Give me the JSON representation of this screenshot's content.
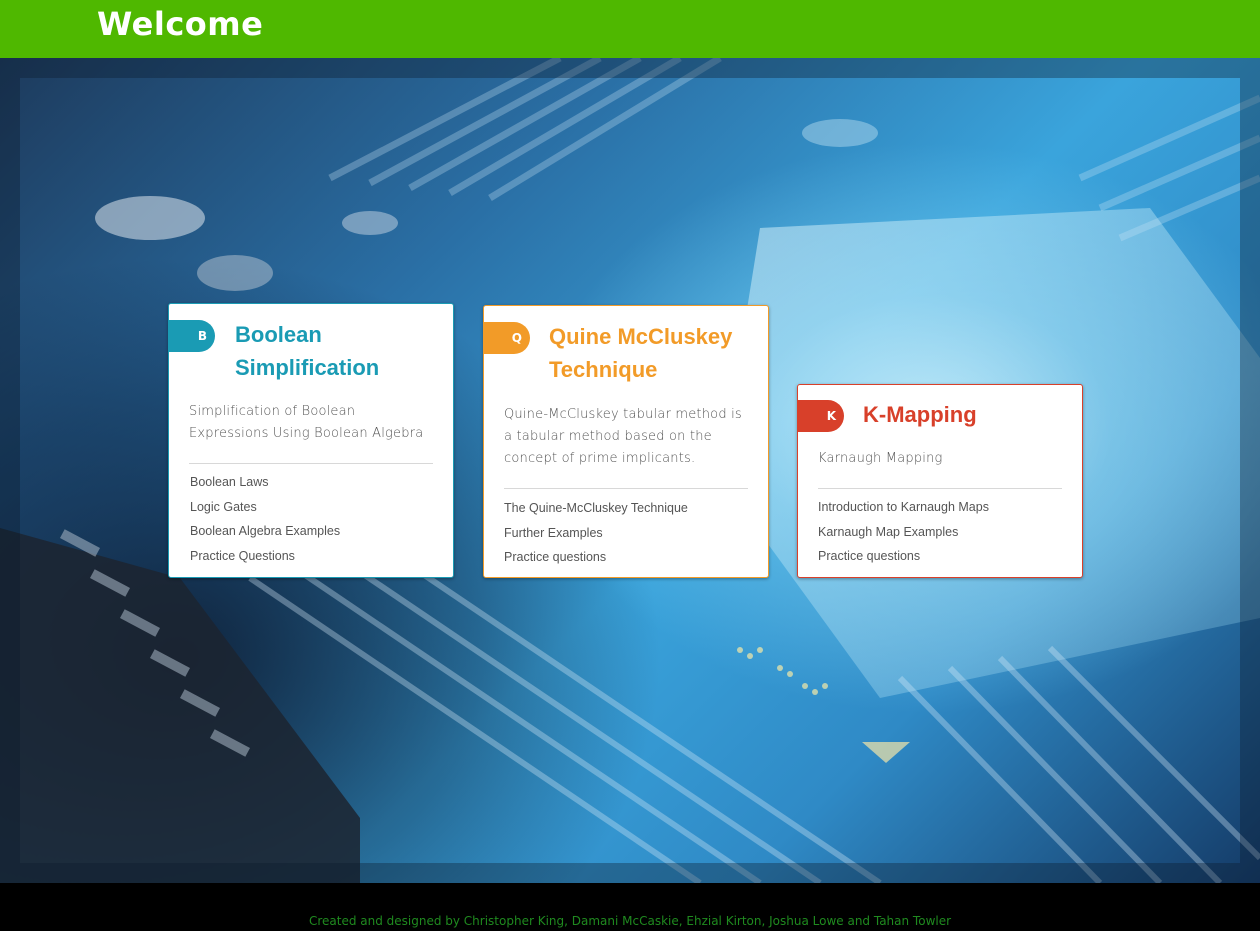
{
  "header": {
    "title": "Welcome",
    "background_color": "#4fb800"
  },
  "background": {
    "description_icon": "circuit-board-background"
  },
  "cards": [
    {
      "key": "boolean",
      "badge": "B",
      "title": "Boolean Simplification",
      "description": "Simplification of Boolean Expressions Using Boolean Algebra",
      "color": "#1a9bb4",
      "links": [
        "Boolean Laws",
        "Logic Gates",
        "Boolean Algebra Examples",
        "Practice Questions"
      ]
    },
    {
      "key": "quine",
      "badge": "Q",
      "title": "Quine McCluskey Technique",
      "description": "Quine-McCluskey tabular method is a tabular method based on the concept of prime implicants.",
      "color": "#f29b28",
      "links": [
        "The Quine-McCluskey Technique",
        "Further Examples",
        "Practice questions"
      ]
    },
    {
      "key": "kmap",
      "badge": "K",
      "title": "K-Mapping",
      "description": "Karnaugh Mapping",
      "color": "#d8402a",
      "links": [
        "Introduction to Karnaugh Maps",
        "Karnaugh Map Examples",
        "Practice questions"
      ]
    }
  ],
  "footer": {
    "credits": "Created and designed by Christopher King, Damani McCaskie, Ehzial Kirton, Joshua Lowe and Tahan Towler",
    "text_color": "#1f8a1f"
  }
}
